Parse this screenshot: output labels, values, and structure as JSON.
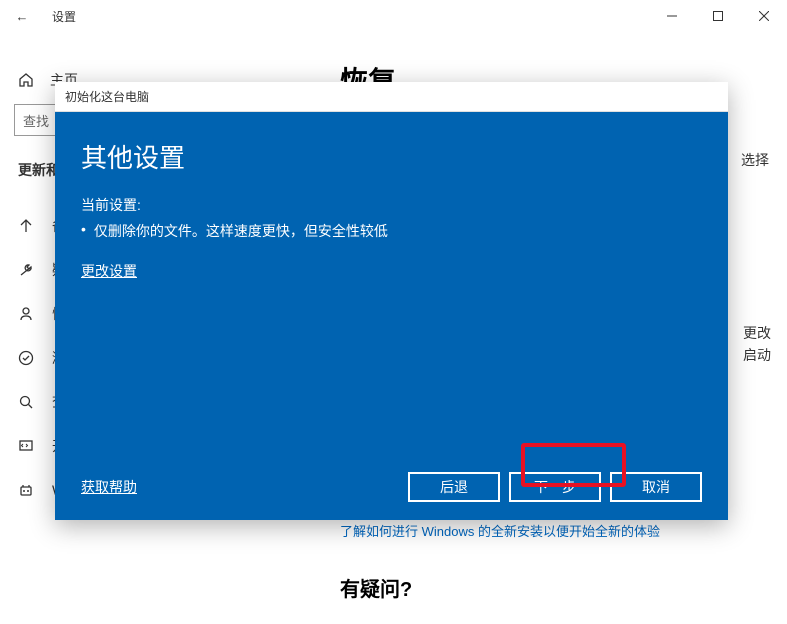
{
  "titlebar": {
    "title": "设置",
    "back_arrow": "←",
    "min": "—",
    "max": "▢",
    "close": "✕"
  },
  "sidebar": {
    "home_label": "主页",
    "search_placeholder": "查找设置",
    "search_display": "查找",
    "category": "更新和",
    "items": [
      {
        "icon": "up-arrow",
        "label": "备"
      },
      {
        "icon": "wrench",
        "label": "疑"
      },
      {
        "icon": "person",
        "label": "恢"
      },
      {
        "icon": "check-circle",
        "label": "激"
      },
      {
        "icon": "search",
        "label": "查"
      },
      {
        "icon": "code",
        "label": "开"
      },
      {
        "icon": "robot",
        "label": "Windows 预览体验计划"
      }
    ]
  },
  "main": {
    "heading": "恢复",
    "right_side_text_1": "选择",
    "right_side_text_2": "更改",
    "right_side_text_3": "启动",
    "bottom_link": "了解如何进行 Windows 的全新安装以便开始全新的体验",
    "question": "有疑问?"
  },
  "dialog": {
    "title": "初始化这台电脑",
    "heading": "其他设置",
    "current_label": "当前设置:",
    "bullet": "仅删除你的文件。这样速度更快，但安全性较低",
    "change_link": "更改设置",
    "help_link": "获取帮助",
    "buttons": {
      "back": "后退",
      "next": "下一步",
      "cancel": "取消"
    }
  }
}
